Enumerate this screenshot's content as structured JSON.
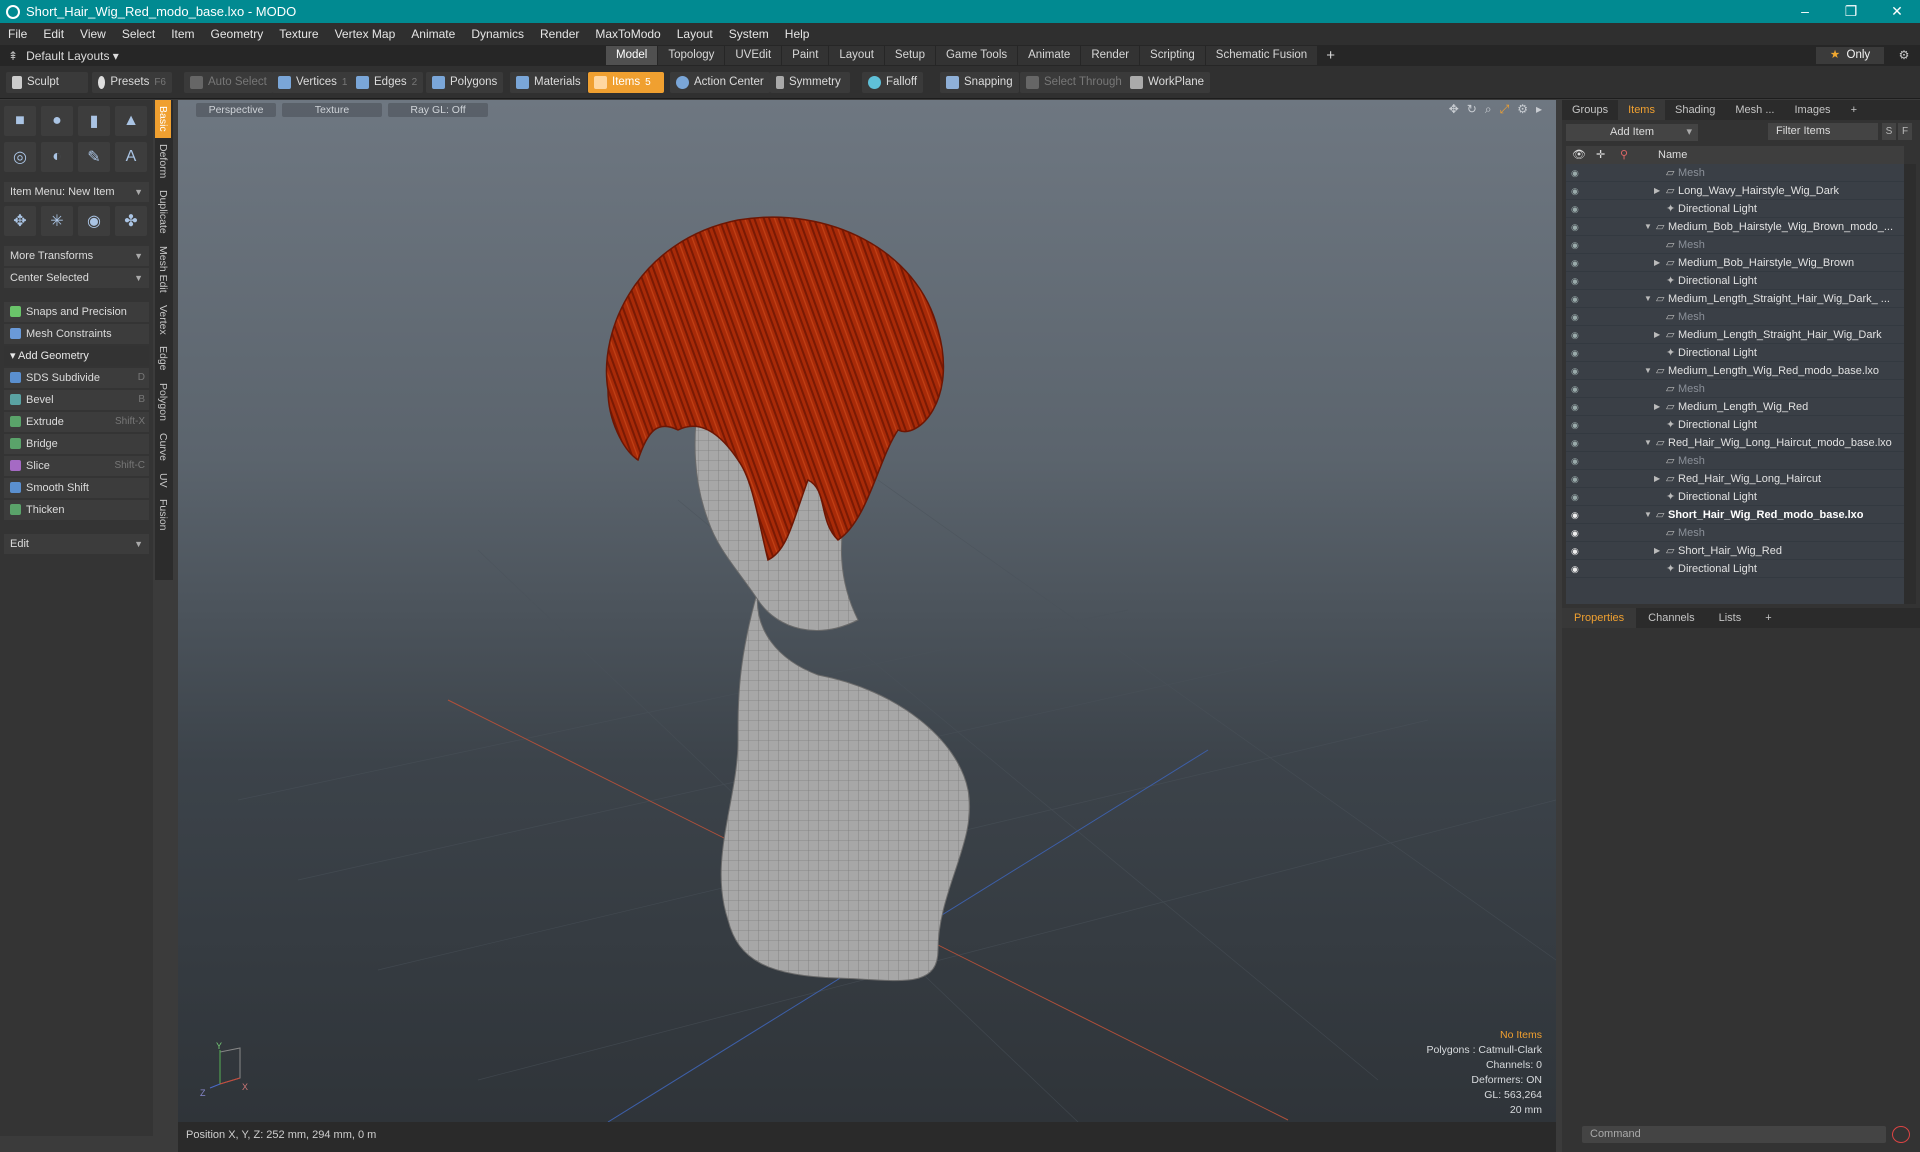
{
  "window": {
    "title": "Short_Hair_Wig_Red_modo_base.lxo - MODO",
    "minimize": "–",
    "restore": "❐",
    "close": "✕"
  },
  "menu": [
    "File",
    "Edit",
    "View",
    "Select",
    "Item",
    "Geometry",
    "Texture",
    "Vertex Map",
    "Animate",
    "Dynamics",
    "Render",
    "MaxToModo",
    "Layout",
    "System",
    "Help"
  ],
  "layouts": {
    "label": "Default Layouts ▾",
    "tabs": [
      "Model",
      "Topology",
      "UVEdit",
      "Paint",
      "Layout",
      "Setup",
      "Game Tools",
      "Animate",
      "Render",
      "Scripting",
      "Schematic Fusion"
    ],
    "active": "Model",
    "only": "Only"
  },
  "toolbar": {
    "sculpt": "Sculpt",
    "presets": "Presets",
    "presets_key": "F6",
    "auto_select": "Auto Select",
    "vertices": "Vertices",
    "vertices_key": "1",
    "edges": "Edges",
    "edges_key": "2",
    "polygons": "Polygons",
    "materials": "Materials",
    "items": "Items",
    "items_key": "5",
    "action_center": "Action Center",
    "symmetry": "Symmetry",
    "falloff": "Falloff",
    "snapping": "Snapping",
    "select_through": "Select Through",
    "workplane": "WorkPlane"
  },
  "left_tabs": [
    "Basic",
    "Deform",
    "Duplicate",
    "Mesh Edit",
    "Vertex",
    "Edge",
    "Polygon",
    "Curve",
    "UV",
    "Fusion"
  ],
  "left": {
    "item_menu": "Item Menu: New Item",
    "more_transforms": "More Transforms",
    "center_selected": "Center Selected",
    "snaps": "Snaps and Precision",
    "mesh_constraints": "Mesh Constraints",
    "add_geometry": "Add Geometry",
    "tools": [
      {
        "label": "SDS Subdivide",
        "key": "D",
        "color": "#5a8fcf"
      },
      {
        "label": "Bevel",
        "key": "B",
        "color": "#5aa3a3"
      },
      {
        "label": "Extrude",
        "key": "Shift-X",
        "color": "#5aa36a"
      },
      {
        "label": "Bridge",
        "key": "",
        "color": "#5aa36a"
      },
      {
        "label": "Slice",
        "key": "Shift-C",
        "color": "#a56ac4"
      },
      {
        "label": "Smooth Shift",
        "key": "",
        "color": "#5a8fcf"
      },
      {
        "label": "Thicken",
        "key": "",
        "color": "#5aa36a"
      }
    ],
    "edit": "Edit"
  },
  "viewport": {
    "tabs": [
      "Perspective",
      "Texture",
      "Ray GL: Off"
    ],
    "info": {
      "no_items": "No Items",
      "polygons": "Polygons : Catmull-Clark",
      "channels": "Channels: 0",
      "deformers": "Deformers: ON",
      "gl": "GL: 563,264",
      "scale": "20 mm"
    },
    "axis": {
      "y": "Y",
      "z": "Z",
      "x": "X"
    }
  },
  "status": "Position X, Y, Z:   252 mm, 294 mm, 0 m",
  "right": {
    "tabs": [
      "Groups",
      "Items",
      "Shading",
      "Mesh ...",
      "Images"
    ],
    "active_tab": "Items",
    "add_item": "Add Item",
    "filter": "Filter Items",
    "filter_btns": [
      "S",
      "F"
    ],
    "name_header": "Name",
    "tree": [
      {
        "label": "Mesh",
        "indent": 2,
        "dim": true
      },
      {
        "label": "Long_Wavy_Hairstyle_Wig_Dark",
        "indent": 2,
        "tri": "▶"
      },
      {
        "label": "Directional Light",
        "indent": 2
      },
      {
        "label": "Medium_Bob_Hairstyle_Wig_Brown_modo_...",
        "indent": 1,
        "tri": "▼"
      },
      {
        "label": "Mesh",
        "indent": 2,
        "dim": true
      },
      {
        "label": "Medium_Bob_Hairstyle_Wig_Brown",
        "indent": 2,
        "tri": "▶"
      },
      {
        "label": "Directional Light",
        "indent": 2
      },
      {
        "label": "Medium_Length_Straight_Hair_Wig_Dark_ ...",
        "indent": 1,
        "tri": "▼"
      },
      {
        "label": "Mesh",
        "indent": 2,
        "dim": true
      },
      {
        "label": "Medium_Length_Straight_Hair_Wig_Dark",
        "indent": 2,
        "tri": "▶"
      },
      {
        "label": "Directional Light",
        "indent": 2
      },
      {
        "label": "Medium_Length_Wig_Red_modo_base.lxo",
        "indent": 1,
        "tri": "▼"
      },
      {
        "label": "Mesh",
        "indent": 2,
        "dim": true
      },
      {
        "label": "Medium_Length_Wig_Red",
        "indent": 2,
        "tri": "▶"
      },
      {
        "label": "Directional Light",
        "indent": 2
      },
      {
        "label": "Red_Hair_Wig_Long_Haircut_modo_base.lxo",
        "indent": 1,
        "tri": "▼"
      },
      {
        "label": "Mesh",
        "indent": 2,
        "dim": true
      },
      {
        "label": "Red_Hair_Wig_Long_Haircut",
        "indent": 2,
        "tri": "▶"
      },
      {
        "label": "Directional Light",
        "indent": 2
      },
      {
        "label": "Short_Hair_Wig_Red_modo_base.lxo",
        "indent": 1,
        "tri": "▼",
        "bold": true,
        "on": true
      },
      {
        "label": "Mesh",
        "indent": 2,
        "dim": true,
        "on": true
      },
      {
        "label": "Short_Hair_Wig_Red",
        "indent": 2,
        "tri": "▶",
        "on": true
      },
      {
        "label": "Directional Light",
        "indent": 2,
        "on": true
      }
    ],
    "tabs2": [
      "Properties",
      "Channels",
      "Lists"
    ],
    "active_tab2": "Properties",
    "command": "Command"
  },
  "colors": {
    "accent": "#f0a030",
    "titlebar": "#018a91",
    "hair": "#a82a08"
  }
}
